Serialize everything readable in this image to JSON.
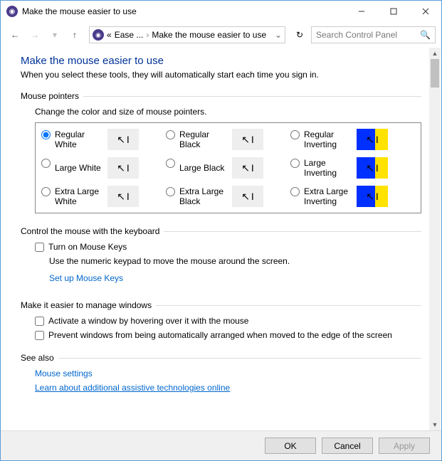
{
  "window": {
    "title": "Make the mouse easier to use"
  },
  "breadcrumb": {
    "part1": "Ease ...",
    "part2": "Make the mouse easier to use"
  },
  "search": {
    "placeholder": "Search Control Panel"
  },
  "page": {
    "title": "Make the mouse easier to use",
    "subtitle": "When you select these tools, they will automatically start each time you sign in."
  },
  "pointers": {
    "group_label": "Mouse pointers",
    "hint": "Change the color and size of mouse pointers.",
    "options": [
      {
        "label": "Regular\nWhite",
        "variant": "white",
        "checked": true
      },
      {
        "label": "Regular\nBlack",
        "variant": "black",
        "checked": false
      },
      {
        "label": "Regular\nInverting",
        "variant": "inv",
        "checked": false
      },
      {
        "label": "Large White",
        "variant": "white",
        "checked": false
      },
      {
        "label": "Large Black",
        "variant": "black",
        "checked": false
      },
      {
        "label": "Large\nInverting",
        "variant": "inv",
        "checked": false
      },
      {
        "label": "Extra Large\nWhite",
        "variant": "white",
        "checked": false
      },
      {
        "label": "Extra Large\nBlack",
        "variant": "black",
        "checked": false
      },
      {
        "label": "Extra Large\nInverting",
        "variant": "inv",
        "checked": false
      }
    ]
  },
  "keyboard": {
    "group_label": "Control the mouse with the keyboard",
    "mouse_keys_label": "Turn on Mouse Keys",
    "mouse_keys_desc": "Use the numeric keypad to move the mouse around the screen.",
    "setup_link": "Set up Mouse Keys"
  },
  "windows": {
    "group_label": "Make it easier to manage windows",
    "hover_label": "Activate a window by hovering over it with the mouse",
    "snap_label": "Prevent windows from being automatically arranged when moved to the edge of the screen"
  },
  "see_also": {
    "group_label": "See also",
    "link1": "Mouse settings",
    "link2": "Learn about additional assistive technologies online"
  },
  "footer": {
    "ok": "OK",
    "cancel": "Cancel",
    "apply": "Apply"
  }
}
